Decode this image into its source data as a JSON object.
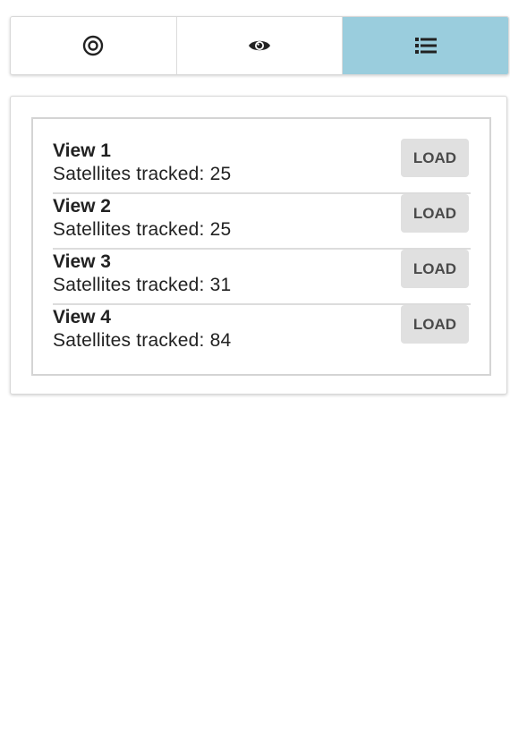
{
  "tabs": [
    {
      "icon": "target-icon",
      "active": false
    },
    {
      "icon": "eye-icon",
      "active": false
    },
    {
      "icon": "list-icon",
      "active": true
    }
  ],
  "colors": {
    "active_tab": "#9acddd",
    "button_bg": "#e0e0e0"
  },
  "views": [
    {
      "title": "View 1",
      "subtitle": "Satellites tracked: 25",
      "button": "LOAD"
    },
    {
      "title": "View 2",
      "subtitle": "Satellites tracked: 25",
      "button": "LOAD"
    },
    {
      "title": "View 3",
      "subtitle": "Satellites tracked: 31",
      "button": "LOAD"
    },
    {
      "title": "View 4",
      "subtitle": "Satellites tracked: 84",
      "button": "LOAD"
    }
  ]
}
